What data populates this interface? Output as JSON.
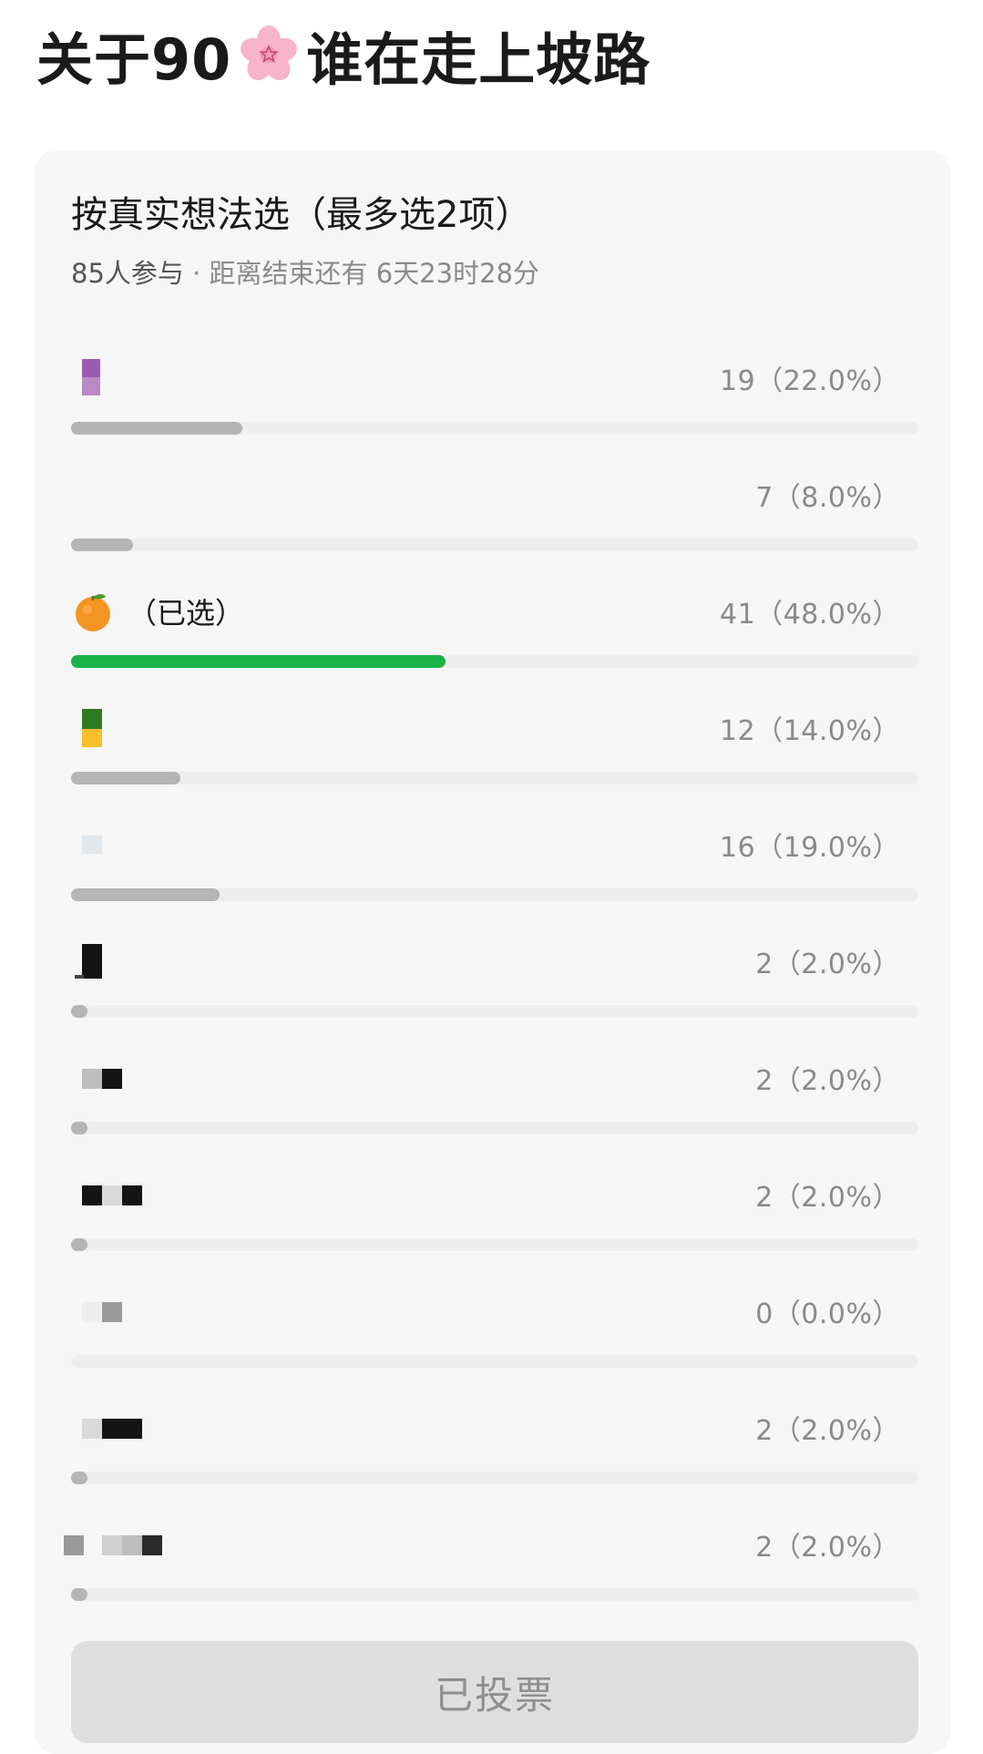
{
  "poll": {
    "title_prefix": "关于90",
    "title_icon": "cherry-blossom-icon",
    "title_suffix": "谁在走上坡路",
    "subtitle": "按真实想法选（最多选2项）",
    "participants": "85人参与",
    "time_left": " · 距离结束还有 6天23时28分",
    "options": [
      {
        "count_text": "19（22.0%）",
        "percent": 22.0,
        "icon": "purple-blocks-icon",
        "selected": false
      },
      {
        "count_text": "7（8.0%）",
        "percent": 8.0,
        "icon": "none",
        "selected": false
      },
      {
        "count_text": "41（48.0%）",
        "percent": 48.0,
        "icon": "tangerine-icon",
        "selected": true,
        "selected_label": "（已选）"
      },
      {
        "count_text": "12（14.0%）",
        "percent": 14.0,
        "icon": "green-yellow-blocks-icon",
        "selected": false
      },
      {
        "count_text": "16（19.0%）",
        "percent": 19.0,
        "icon": "pale-block-icon",
        "selected": false
      },
      {
        "count_text": "2（2.0%）",
        "percent": 2.0,
        "icon": "black-block-icon",
        "selected": false
      },
      {
        "count_text": "2（2.0%）",
        "percent": 2.0,
        "icon": "grey-black-blocks-icon",
        "selected": false
      },
      {
        "count_text": "2（2.0%）",
        "percent": 2.0,
        "icon": "black-grey-black-blocks-icon",
        "selected": false
      },
      {
        "count_text": "0（0.0%）",
        "percent": 0.0,
        "icon": "grey-block-icon",
        "selected": false
      },
      {
        "count_text": "2（2.0%）",
        "percent": 2.0,
        "icon": "light-black-blocks-icon",
        "selected": false
      },
      {
        "count_text": "2（2.0%）",
        "percent": 2.0,
        "icon": "mixed-blocks-icon",
        "selected": false
      }
    ],
    "button_label": "已投票"
  },
  "colors": {
    "bar_selected": "#19b347",
    "bar_default": "#b5b5b5",
    "bar_track": "#eeeeee",
    "card_bg": "#f6f6f6"
  }
}
